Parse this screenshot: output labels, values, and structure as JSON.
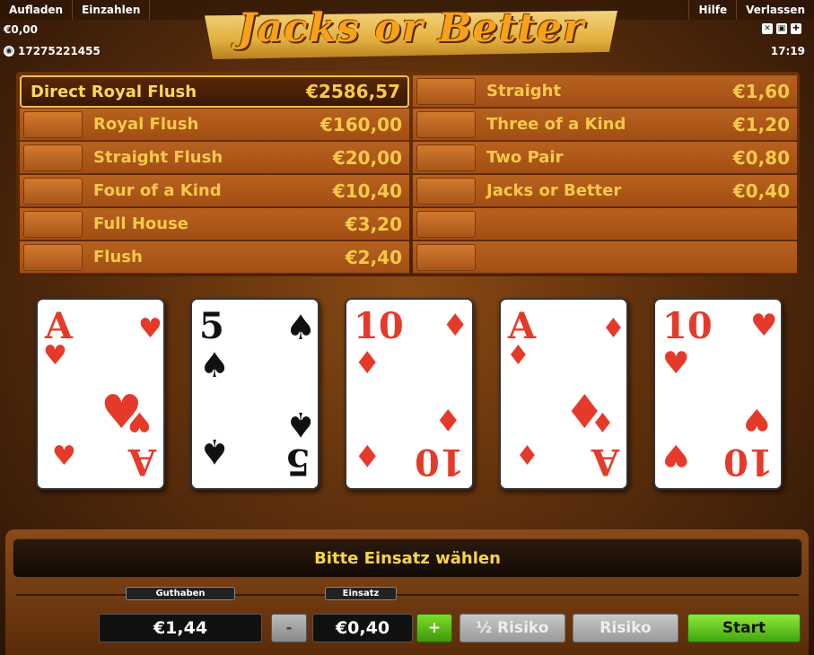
{
  "topbar": {
    "aufladen": "Aufladen",
    "einzahlen": "Einzahlen",
    "hilfe": "Hilfe",
    "verlassen": "Verlassen",
    "balance": "€0,00",
    "session_id": "17275221455",
    "time": "17:19"
  },
  "logo": {
    "title": "Jacks or Better"
  },
  "paytable": {
    "left": [
      {
        "name": "Direct Royal Flush",
        "value": "€2586,57"
      },
      {
        "name": "Royal Flush",
        "value": "€160,00"
      },
      {
        "name": "Straight Flush",
        "value": "€20,00"
      },
      {
        "name": "Four of a Kind",
        "value": "€10,40"
      },
      {
        "name": "Full House",
        "value": "€3,20"
      },
      {
        "name": "Flush",
        "value": "€2,40"
      }
    ],
    "right": [
      {
        "name": "Straight",
        "value": "€1,60"
      },
      {
        "name": "Three of a Kind",
        "value": "€1,20"
      },
      {
        "name": "Two Pair",
        "value": "€0,80"
      },
      {
        "name": "Jacks or Better",
        "value": "€0,40"
      },
      {
        "name": "",
        "value": ""
      },
      {
        "name": "",
        "value": ""
      }
    ]
  },
  "cards": [
    {
      "rank": "A",
      "suit": "hearts",
      "glyph": "♥",
      "color": "#e53a2a"
    },
    {
      "rank": "5",
      "suit": "spades",
      "glyph": "♠",
      "color": "#111111"
    },
    {
      "rank": "10",
      "suit": "diamonds",
      "glyph": "♦",
      "color": "#e53a2a"
    },
    {
      "rank": "A",
      "suit": "diamonds",
      "glyph": "♦",
      "color": "#e53a2a"
    },
    {
      "rank": "10",
      "suit": "hearts",
      "glyph": "♥",
      "color": "#e53a2a"
    }
  ],
  "panel": {
    "message": "Bitte Einsatz wählen",
    "guthaben_label": "Guthaben",
    "guthaben_value": "€1,44",
    "einsatz_label": "Einsatz",
    "einsatz_value": "€0,40",
    "minus_label": "-",
    "plus_label": "+",
    "half_risk_label": "½ Risiko",
    "risk_label": "Risiko",
    "start_label": "Start"
  }
}
